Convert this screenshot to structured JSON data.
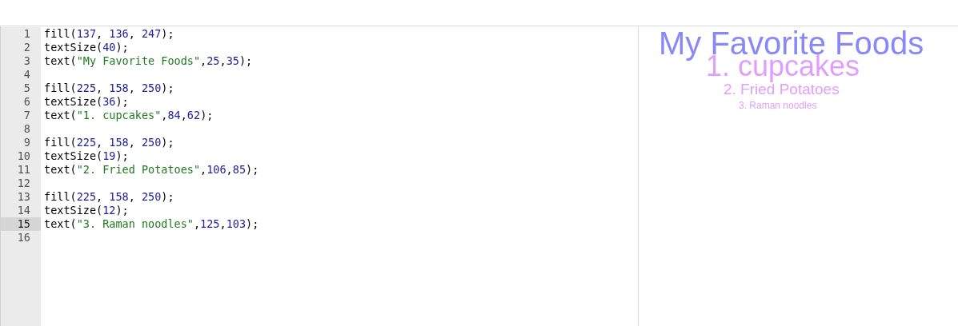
{
  "editor": {
    "lines": [
      {
        "number": "1",
        "selected": false,
        "tokens": [
          {
            "kind": "plain",
            "text": "fill("
          },
          {
            "kind": "number",
            "text": "137"
          },
          {
            "kind": "plain",
            "text": ", "
          },
          {
            "kind": "number",
            "text": "136"
          },
          {
            "kind": "plain",
            "text": ", "
          },
          {
            "kind": "number",
            "text": "247"
          },
          {
            "kind": "plain",
            "text": ");"
          }
        ]
      },
      {
        "number": "2",
        "selected": false,
        "tokens": [
          {
            "kind": "plain",
            "text": "textSize("
          },
          {
            "kind": "number",
            "text": "40"
          },
          {
            "kind": "plain",
            "text": ");"
          }
        ]
      },
      {
        "number": "3",
        "selected": false,
        "tokens": [
          {
            "kind": "plain",
            "text": "text("
          },
          {
            "kind": "string",
            "text": "\"My Favorite Foods\""
          },
          {
            "kind": "plain",
            "text": ","
          },
          {
            "kind": "number",
            "text": "25"
          },
          {
            "kind": "plain",
            "text": ","
          },
          {
            "kind": "number",
            "text": "35"
          },
          {
            "kind": "plain",
            "text": ");"
          }
        ]
      },
      {
        "number": "4",
        "selected": false
      },
      {
        "number": "5",
        "selected": false,
        "tokens": [
          {
            "kind": "plain",
            "text": "fill("
          },
          {
            "kind": "number",
            "text": "225"
          },
          {
            "kind": "plain",
            "text": ", "
          },
          {
            "kind": "number",
            "text": "158"
          },
          {
            "kind": "plain",
            "text": ", "
          },
          {
            "kind": "number",
            "text": "250"
          },
          {
            "kind": "plain",
            "text": ");"
          }
        ]
      },
      {
        "number": "6",
        "selected": false,
        "tokens": [
          {
            "kind": "plain",
            "text": "textSize("
          },
          {
            "kind": "number",
            "text": "36"
          },
          {
            "kind": "plain",
            "text": ");"
          }
        ]
      },
      {
        "number": "7",
        "selected": false,
        "tokens": [
          {
            "kind": "plain",
            "text": "text("
          },
          {
            "kind": "string",
            "text": "\"1. cupcakes\""
          },
          {
            "kind": "plain",
            "text": ","
          },
          {
            "kind": "number",
            "text": "84"
          },
          {
            "kind": "plain",
            "text": ","
          },
          {
            "kind": "number",
            "text": "62"
          },
          {
            "kind": "plain",
            "text": ");"
          }
        ]
      },
      {
        "number": "8",
        "selected": false
      },
      {
        "number": "9",
        "selected": false,
        "tokens": [
          {
            "kind": "plain",
            "text": "fill("
          },
          {
            "kind": "number",
            "text": "225"
          },
          {
            "kind": "plain",
            "text": ", "
          },
          {
            "kind": "number",
            "text": "158"
          },
          {
            "kind": "plain",
            "text": ", "
          },
          {
            "kind": "number",
            "text": "250"
          },
          {
            "kind": "plain",
            "text": ");"
          }
        ]
      },
      {
        "number": "10",
        "selected": false,
        "tokens": [
          {
            "kind": "plain",
            "text": "textSize("
          },
          {
            "kind": "number",
            "text": "19"
          },
          {
            "kind": "plain",
            "text": ");"
          }
        ]
      },
      {
        "number": "11",
        "selected": false,
        "tokens": [
          {
            "kind": "plain",
            "text": "text("
          },
          {
            "kind": "string",
            "text": "\"2. Fried Potatoes\""
          },
          {
            "kind": "plain",
            "text": ","
          },
          {
            "kind": "number",
            "text": "106"
          },
          {
            "kind": "plain",
            "text": ","
          },
          {
            "kind": "number",
            "text": "85"
          },
          {
            "kind": "plain",
            "text": ");"
          }
        ]
      },
      {
        "number": "12",
        "selected": false
      },
      {
        "number": "13",
        "selected": false,
        "tokens": [
          {
            "kind": "plain",
            "text": "fill("
          },
          {
            "kind": "number",
            "text": "225"
          },
          {
            "kind": "plain",
            "text": ", "
          },
          {
            "kind": "number",
            "text": "158"
          },
          {
            "kind": "plain",
            "text": ", "
          },
          {
            "kind": "number",
            "text": "250"
          },
          {
            "kind": "plain",
            "text": ");"
          }
        ]
      },
      {
        "number": "14",
        "selected": false,
        "tokens": [
          {
            "kind": "plain",
            "text": "textSize("
          },
          {
            "kind": "number",
            "text": "12"
          },
          {
            "kind": "plain",
            "text": ");"
          }
        ]
      },
      {
        "number": "15",
        "selected": true,
        "tokens": [
          {
            "kind": "plain",
            "text": "text("
          },
          {
            "kind": "string",
            "text": "\"3. Raman noodles\""
          },
          {
            "kind": "plain",
            "text": ","
          },
          {
            "kind": "number",
            "text": "125"
          },
          {
            "kind": "plain",
            "text": ","
          },
          {
            "kind": "number",
            "text": "103"
          },
          {
            "kind": "plain",
            "text": ");"
          }
        ]
      },
      {
        "number": "16",
        "selected": false
      }
    ]
  },
  "canvas": {
    "texts": [
      {
        "text": "My Favorite Foods",
        "color": "#8988f7"
      },
      {
        "text": "1. cupcakes",
        "color": "#e19efa"
      },
      {
        "text": "2. Fried Potatoes",
        "color": "#e19efa"
      },
      {
        "text": "3. Raman noodles",
        "color": "#e19efa"
      }
    ]
  }
}
